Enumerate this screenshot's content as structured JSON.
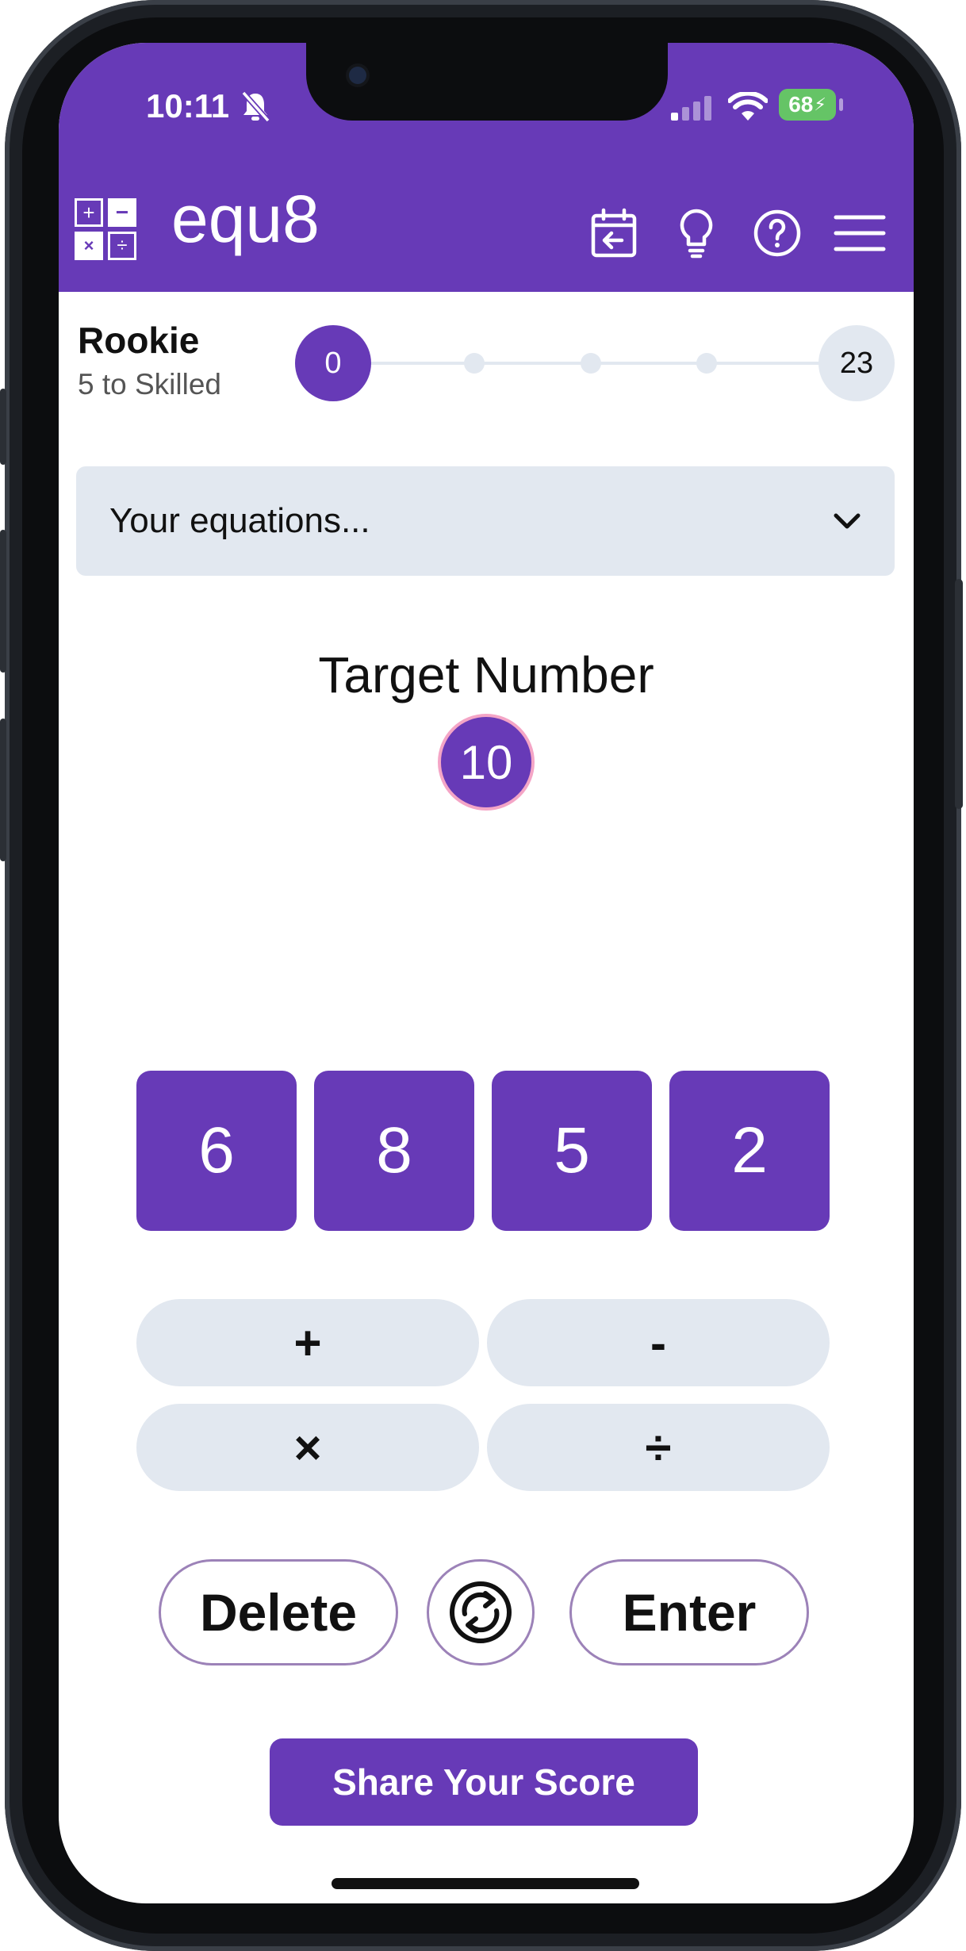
{
  "status_bar": {
    "time": "10:11",
    "battery": "68"
  },
  "header": {
    "app_title": "equ8",
    "logo_symbols": [
      "+",
      "−",
      "×",
      "÷"
    ],
    "icons": [
      "calendar-back-icon",
      "lightbulb-icon",
      "help-icon",
      "menu-icon"
    ]
  },
  "progress": {
    "level_title": "Rookie",
    "level_subtitle": "5 to Skilled",
    "current_score": "0",
    "goal_score": "23",
    "fraction": 0
  },
  "equations_dropdown": {
    "label": "Your equations..."
  },
  "target": {
    "label": "Target Number",
    "value": "10"
  },
  "number_tiles": [
    "6",
    "8",
    "5",
    "2"
  ],
  "operators": [
    "+",
    "-",
    "×",
    "÷"
  ],
  "actions": {
    "delete_label": "Delete",
    "enter_label": "Enter",
    "share_label": "Share Your Score"
  },
  "colors": {
    "primary": "#673ab7",
    "light": "#e2e8f0",
    "target_border": "#f4a5c6"
  }
}
